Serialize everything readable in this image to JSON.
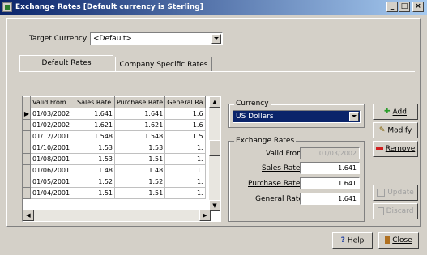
{
  "window": {
    "title": "Exchange Rates [Default currency is Sterling]",
    "controls": [
      "_",
      "□",
      "×"
    ]
  },
  "target_currency": {
    "label": "Target Currency",
    "value": "<Default>"
  },
  "tabs": [
    {
      "label": "Default Rates",
      "active": true
    },
    {
      "label": "Company Specific Rates",
      "active": false
    }
  ],
  "grid": {
    "columns": [
      "Valid From",
      "Sales Rate",
      "Purchase Rate",
      "General Ra"
    ],
    "rows": [
      [
        "01/03/2002",
        "1.641",
        "1.641",
        "1.6"
      ],
      [
        "01/02/2002",
        "1.621",
        "1.621",
        "1.6"
      ],
      [
        "01/12/2001",
        "1.548",
        "1.548",
        "1.5"
      ],
      [
        "01/10/2001",
        "1.53",
        "1.53",
        "1."
      ],
      [
        "01/08/2001",
        "1.53",
        "1.51",
        "1."
      ],
      [
        "01/06/2001",
        "1.48",
        "1.48",
        "1."
      ],
      [
        "01/05/2001",
        "1.52",
        "1.52",
        "1."
      ],
      [
        "01/04/2001",
        "1.51",
        "1.51",
        "1."
      ]
    ]
  },
  "currency": {
    "group_label": "Currency",
    "value": "US Dollars"
  },
  "exchange_rates": {
    "group_label": "Exchange Rates",
    "valid_from_label": "Valid From",
    "valid_from": "01/03/2002",
    "sales_label": "Sales Rate",
    "sales": "1.641",
    "purchase_label": "Purchase Rate",
    "purchase": "1.641",
    "general_label": "General Rate",
    "general": "1.641"
  },
  "buttons": {
    "add": "Add",
    "modify": "Modify",
    "remove": "Remove",
    "update": "Update",
    "discard": "Discard",
    "help": "Help",
    "close": "Close"
  },
  "colors": {
    "title_start": "#0a246a",
    "selection": "#0a246a",
    "add_icon": "#2a9d2a",
    "remove_icon": "#d02020"
  }
}
